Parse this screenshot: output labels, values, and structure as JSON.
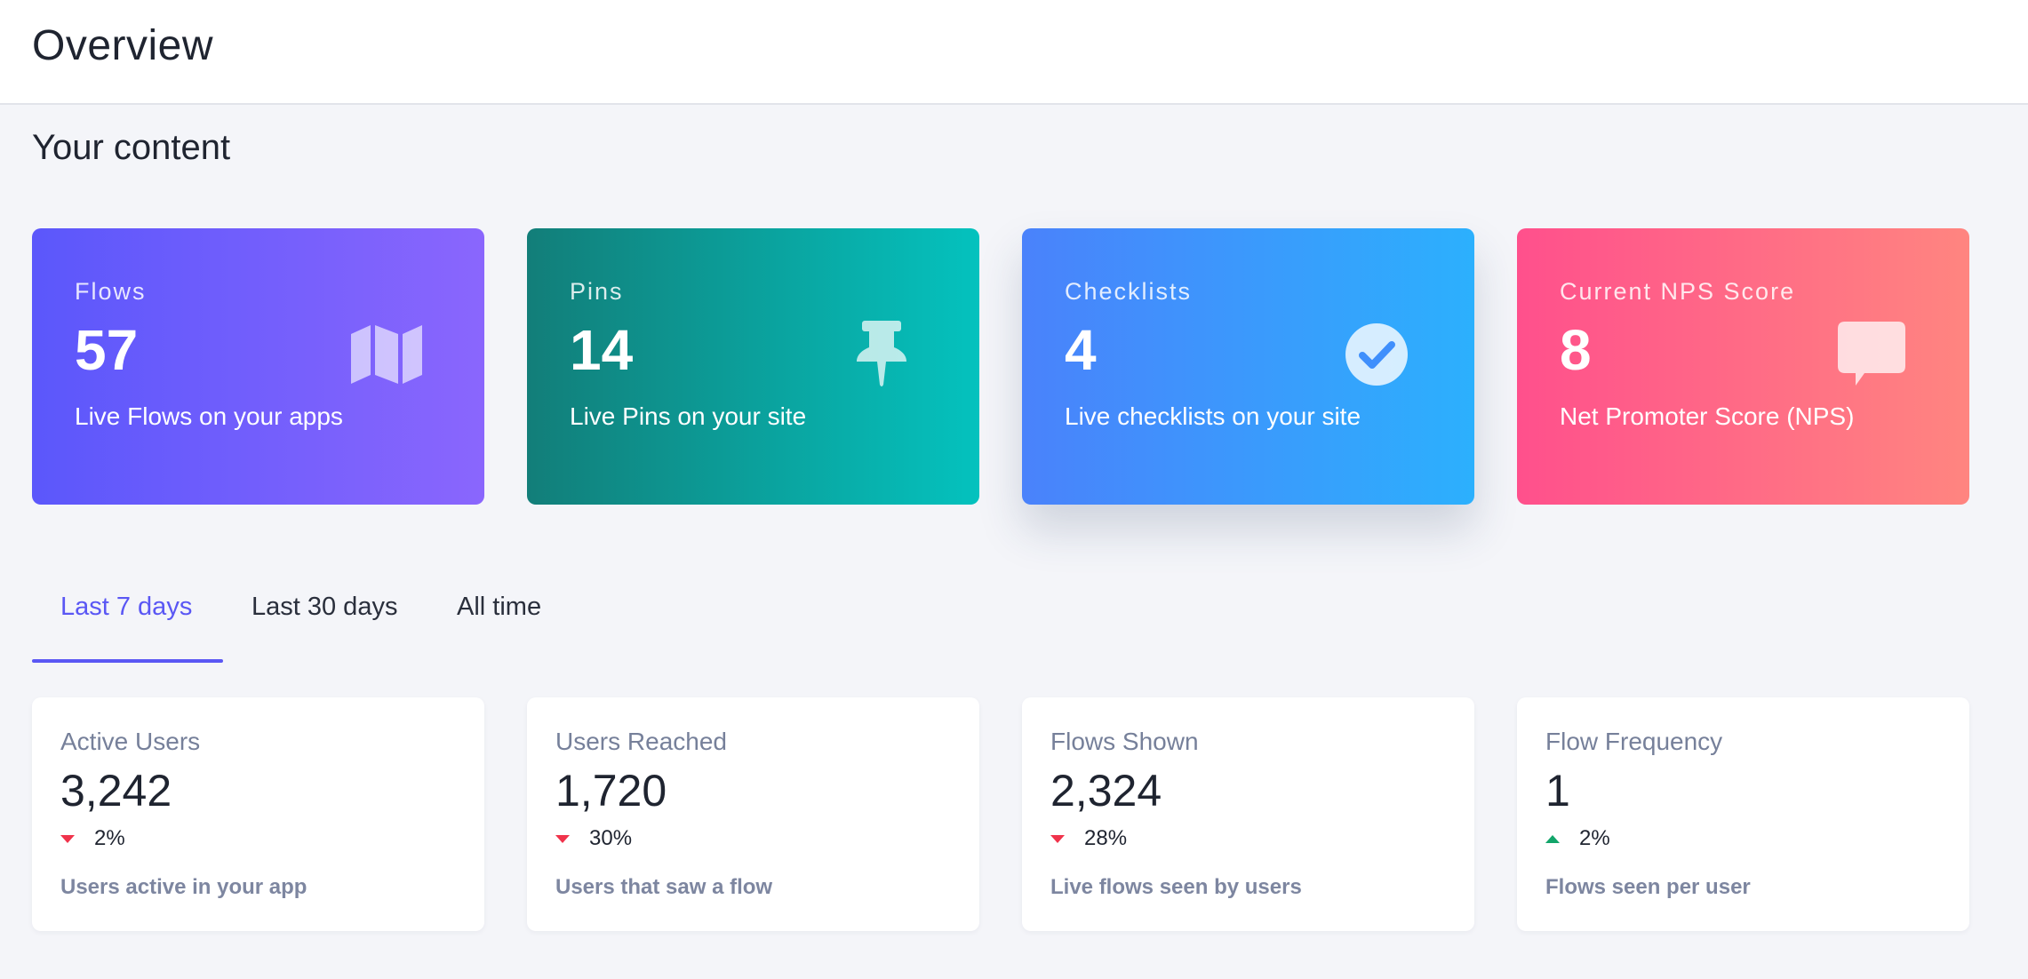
{
  "header": {
    "title": "Overview"
  },
  "section": {
    "title": "Your content"
  },
  "content_cards": [
    {
      "label": "Flows",
      "value": "57",
      "description": "Live Flows on your apps",
      "icon": "map-icon",
      "color_from": "#5b57fb",
      "color_to": "#8a66fd"
    },
    {
      "label": "Pins",
      "value": "14",
      "description": "Live Pins on your site",
      "icon": "pushpin-icon",
      "color_from": "#127e79",
      "color_to": "#04c2be"
    },
    {
      "label": "Checklists",
      "value": "4",
      "description": "Live checklists on your site",
      "icon": "check-circle-icon",
      "color_from": "#4a82fb",
      "color_to": "#2cb0fd"
    },
    {
      "label": "Current NPS Score",
      "value": "8",
      "description": "Net Promoter Score (NPS)",
      "icon": "speech-bubble-icon",
      "color_from": "#ff508c",
      "color_to": "#ff8580"
    }
  ],
  "tabs": [
    {
      "label": "Last 7 days",
      "active": true
    },
    {
      "label": "Last 30 days",
      "active": false
    },
    {
      "label": "All time",
      "active": false
    }
  ],
  "accent_color": "#5a57f4",
  "stats": [
    {
      "label": "Active Users",
      "value": "3,242",
      "change": "2%",
      "direction": "down",
      "description": "Users active in your app"
    },
    {
      "label": "Users Reached",
      "value": "1,720",
      "change": "30%",
      "direction": "down",
      "description": "Users that saw a flow"
    },
    {
      "label": "Flows Shown",
      "value": "2,324",
      "change": "28%",
      "direction": "down",
      "description": "Live flows seen by users"
    },
    {
      "label": "Flow Frequency",
      "value": "1",
      "change": "2%",
      "direction": "up",
      "description": "Flows seen per user"
    }
  ],
  "trend_colors": {
    "down": "#f0334b",
    "up": "#12a56a"
  }
}
